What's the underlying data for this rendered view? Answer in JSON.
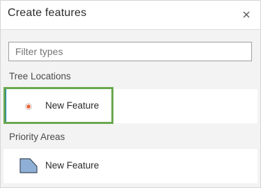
{
  "panel": {
    "title": "Create features",
    "close_icon": "close-icon"
  },
  "filter": {
    "placeholder": "Filter types",
    "value": ""
  },
  "groups": [
    {
      "label": "Tree Locations",
      "items": [
        {
          "label": "New Feature",
          "icon": "point-symbol-icon",
          "selected": true
        }
      ]
    },
    {
      "label": "Priority Areas",
      "items": [
        {
          "label": "New Feature",
          "icon": "polygon-symbol-icon",
          "selected": false
        }
      ]
    }
  ],
  "colors": {
    "selection_bar": "#007ac2",
    "highlight_outline": "#6aa84f",
    "point_fill": "#e8613a",
    "polygon_fill": "#8fb0d6",
    "polygon_stroke": "#3d4a5a"
  }
}
